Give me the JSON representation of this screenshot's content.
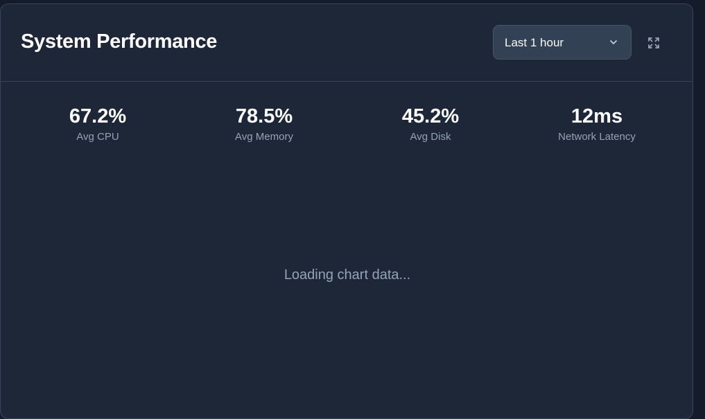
{
  "header": {
    "title": "System Performance",
    "time_range": {
      "selected": "Last 1 hour"
    },
    "expand_icon": "expand-icon"
  },
  "stats": [
    {
      "value": "67.2%",
      "label": "Avg CPU"
    },
    {
      "value": "78.5%",
      "label": "Avg Memory"
    },
    {
      "value": "45.2%",
      "label": "Avg Disk"
    },
    {
      "value": "12ms",
      "label": "Network Latency"
    }
  ],
  "chart": {
    "status_text": "Loading chart data..."
  },
  "colors": {
    "page_background": "#141b2a",
    "card_background": "#1e2738",
    "card_border": "#3a4558",
    "select_background": "#334155",
    "text_primary": "#ffffff",
    "text_muted": "#94a3b8"
  }
}
